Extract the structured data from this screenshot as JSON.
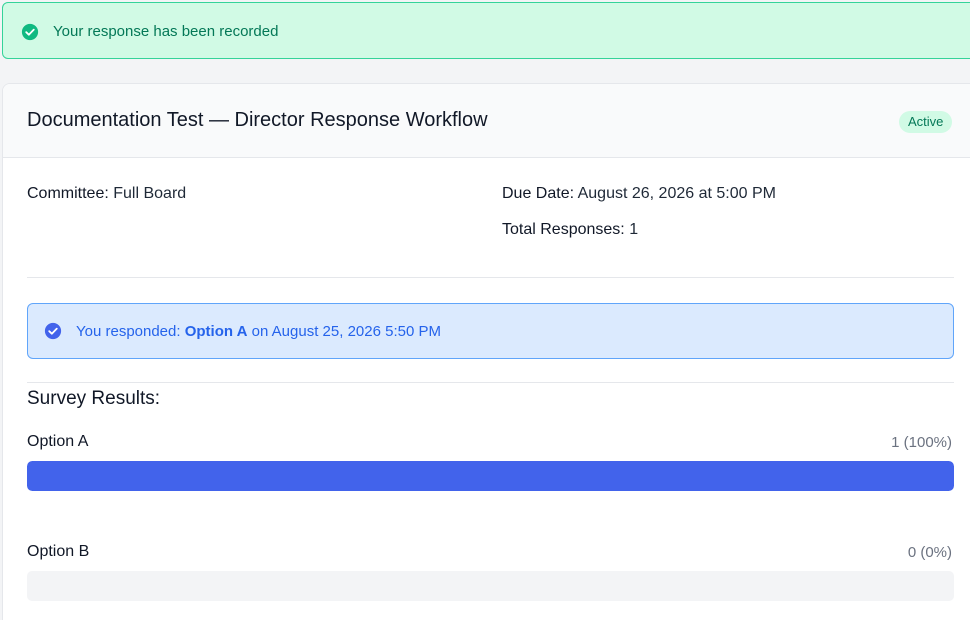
{
  "toast": {
    "message": "Your response has been recorded",
    "icon": "check-circle-icon",
    "color": "#047857"
  },
  "survey": {
    "title": "Documentation Test — Director Response Workflow",
    "status": "Active",
    "committee_label": "Committee:",
    "committee_value": "Full Board",
    "due_label": "Due Date:",
    "due_value": "August 26, 2026 at 5:00 PM",
    "total_label": "Total Responses:",
    "total_value": "1"
  },
  "response_notice": {
    "prefix": "You responded:",
    "option": "Option A",
    "suffix": "on August 25, 2026 5:50 PM",
    "icon": "check-circle-icon"
  },
  "results": {
    "title": "Survey Results:",
    "bar_color": "#4263eb",
    "options": [
      {
        "label": "Option A",
        "count": "1 (100%)",
        "fraction": 1.0
      },
      {
        "label": "Option B",
        "count": "0 (0%)",
        "fraction": 0.0
      }
    ]
  }
}
